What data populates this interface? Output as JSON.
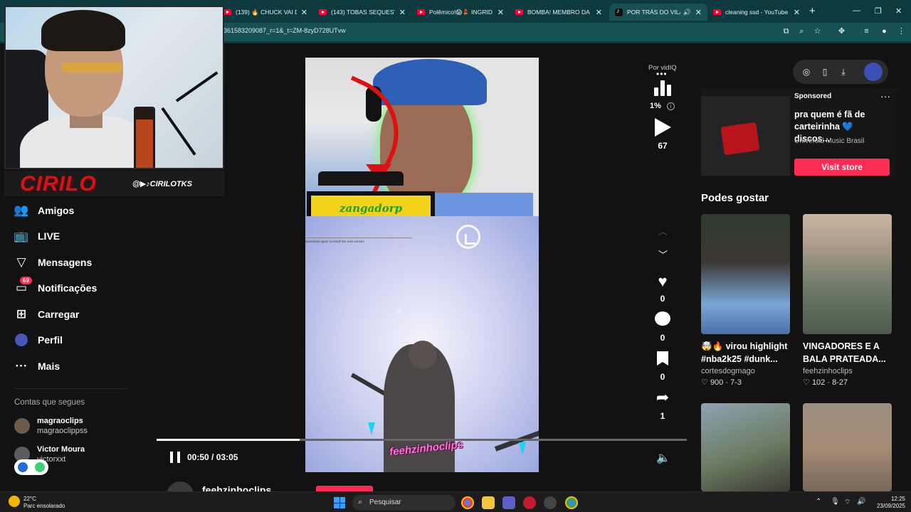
{
  "browser": {
    "tabs": [
      {
        "title": "(139) 🔥 CHUCK VAI DEI",
        "fav": "yt"
      },
      {
        "title": "(143) TOBAS SEQUESTR4",
        "fav": "yt"
      },
      {
        "title": "Polêmico!😱💄 INGRID F",
        "fav": "yt"
      },
      {
        "title": "BOMBA! MEMBRO DA DF",
        "fav": "yt"
      },
      {
        "title": "POR TRÁS DO VILÃO",
        "fav": "tiktok",
        "active": true
      },
      {
        "title": "cleaning ssd - YouTube",
        "fav": "yt"
      }
    ],
    "address": "361583209087_r=1&_t=ZM-8zyD728UTvw"
  },
  "overlay": {
    "brand": "CIRILO",
    "handle": "@▶♪CIRILOTKS"
  },
  "nav": {
    "items": [
      {
        "name": "friends",
        "label": "Amigos",
        "icon": "users-icon"
      },
      {
        "name": "live",
        "label": "LIVE",
        "icon": "tv-icon"
      },
      {
        "name": "messages",
        "label": "Mensagens",
        "icon": "send-icon"
      },
      {
        "name": "notifications",
        "label": "Notificações",
        "icon": "inbox-icon",
        "badge": "69"
      },
      {
        "name": "upload",
        "label": "Carregar",
        "icon": "plus-square-icon"
      },
      {
        "name": "profile",
        "label": "Perfil",
        "icon": "avatar-icon"
      },
      {
        "name": "more",
        "label": "Mais",
        "icon": "ellipsis-icon"
      }
    ],
    "following_title": "Contas que segues",
    "following": [
      {
        "name": "magraoclips",
        "handle": "magraoclippss"
      },
      {
        "name": "Victor Moura",
        "handle": "victorxxt"
      }
    ]
  },
  "video": {
    "overlay_label": "zangadorp",
    "caption": "feehzinhoclips",
    "game_text": "Download again to install the new version",
    "time_current": "00:50",
    "time_total": "03:05",
    "progress": 0.2703,
    "author": "feehzinhoclips"
  },
  "vidiq": {
    "label": "Por vidIQ",
    "percent": "1%",
    "views": "67"
  },
  "actions": {
    "likes": "0",
    "comments": "0",
    "saves": "0",
    "shares": "1"
  },
  "ad": {
    "sponsored": "Sponsored",
    "title": "pra quem é fã de carteirinha 💙 discos...",
    "advertiser": "Universal Music Brasil",
    "cta": "Visit store"
  },
  "recommend": {
    "heading": "Podes gostar",
    "cards": [
      {
        "title": "🤯🔥 virou highlight #nba2k25 #dunk...",
        "author": "cortesdogmago",
        "likes": "900",
        "date": "7-3"
      },
      {
        "title": "VINGADORES E A BALA PRATEADA...",
        "author": "feehzinhoclips",
        "likes": "102",
        "date": "8-27"
      },
      {
        "title": "",
        "author": "",
        "likes": "",
        "date": ""
      },
      {
        "title": "",
        "author": "",
        "likes": "",
        "date": ""
      }
    ]
  },
  "taskbar": {
    "temp": "22°C",
    "weather": "Parc ensolarado",
    "search": "Pesquisar",
    "time": "12:25",
    "date": "23/09/2025"
  },
  "colors": {
    "accent": "#fe2c55",
    "chrome": "#0c3a3e"
  }
}
